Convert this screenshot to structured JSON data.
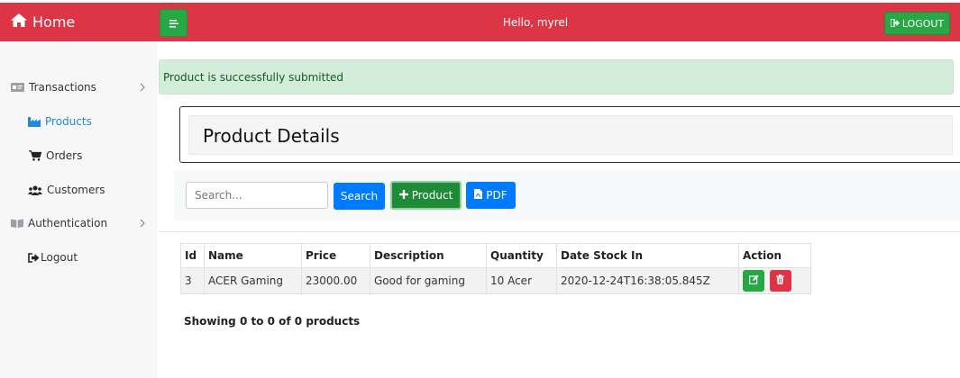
{
  "header": {
    "brand": "Home",
    "greeting": "Hello, myrel",
    "logout_label": "LOGOUT"
  },
  "sidebar": {
    "items": [
      {
        "label": "Transactions",
        "icon": "id-card-icon",
        "has_chevron": true
      },
      {
        "label": "Products",
        "icon": "industry-icon",
        "active": true
      },
      {
        "label": "Orders",
        "icon": "cart-icon"
      },
      {
        "label": "Customers",
        "icon": "users-icon"
      },
      {
        "label": "Authentication",
        "icon": "book-icon",
        "has_chevron": true
      },
      {
        "label": "Logout",
        "icon": "sign-out-icon"
      }
    ]
  },
  "alert": {
    "message": "Product is successfully submitted"
  },
  "card": {
    "title": "Product Details"
  },
  "toolbar": {
    "search_placeholder": "Search...",
    "search_value": "",
    "search_label": "Search",
    "add_product_label": "Product",
    "pdf_label": "PDF"
  },
  "table": {
    "columns": [
      "Id",
      "Name",
      "Price",
      "Description",
      "Quantity",
      "Date Stock In",
      "Action"
    ],
    "rows": [
      [
        "3",
        "ACER Gaming",
        "23000.00",
        "Good for gaming",
        "10 Acer",
        "2020-12-24T16:38:05.845Z"
      ]
    ]
  },
  "footer": {
    "showing": "Showing 0 to 0 of 0 products"
  },
  "colors": {
    "header_red": "#dc3545",
    "success_green": "#28a745",
    "primary_blue": "#007bff",
    "alert_green_bg": "#d4edda"
  }
}
